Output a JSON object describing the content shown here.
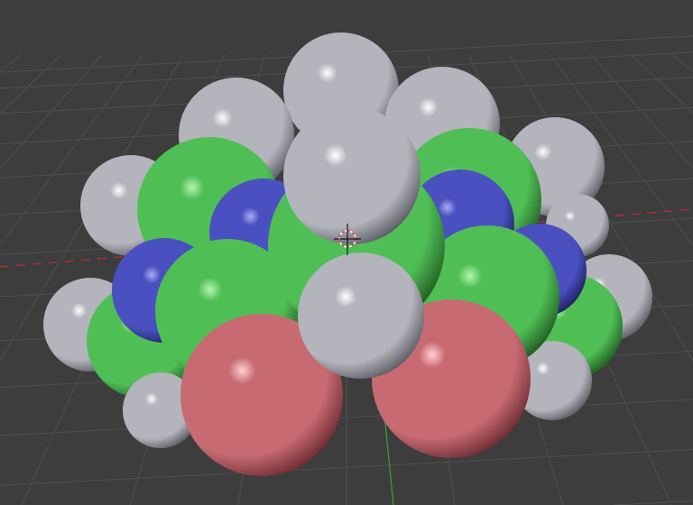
{
  "viewport": {
    "background": "#3d3d3d",
    "grid_color": "#4f4f4f",
    "x_axis_color": "#b03030",
    "y_axis_color": "#3aa03a"
  },
  "atom_colors": {
    "hydrogen": {
      "base": "#b4b4bc",
      "highlight": "#ffffff",
      "shade": "#5a5a62"
    },
    "carbon": {
      "base": "#4fbf55",
      "highlight": "#b6f5b0",
      "shade": "#1f5a22"
    },
    "nitrogen": {
      "base": "#4a50c0",
      "highlight": "#a9aef5",
      "shade": "#1c1f5c"
    },
    "oxygen": {
      "base": "#c86a72",
      "highlight": "#ffd0d4",
      "shade": "#6a2a30"
    }
  },
  "molecule": {
    "atom_counts": {
      "hydrogen": 12,
      "carbon": 7,
      "nitrogen": 4,
      "oxygen": 2
    }
  }
}
